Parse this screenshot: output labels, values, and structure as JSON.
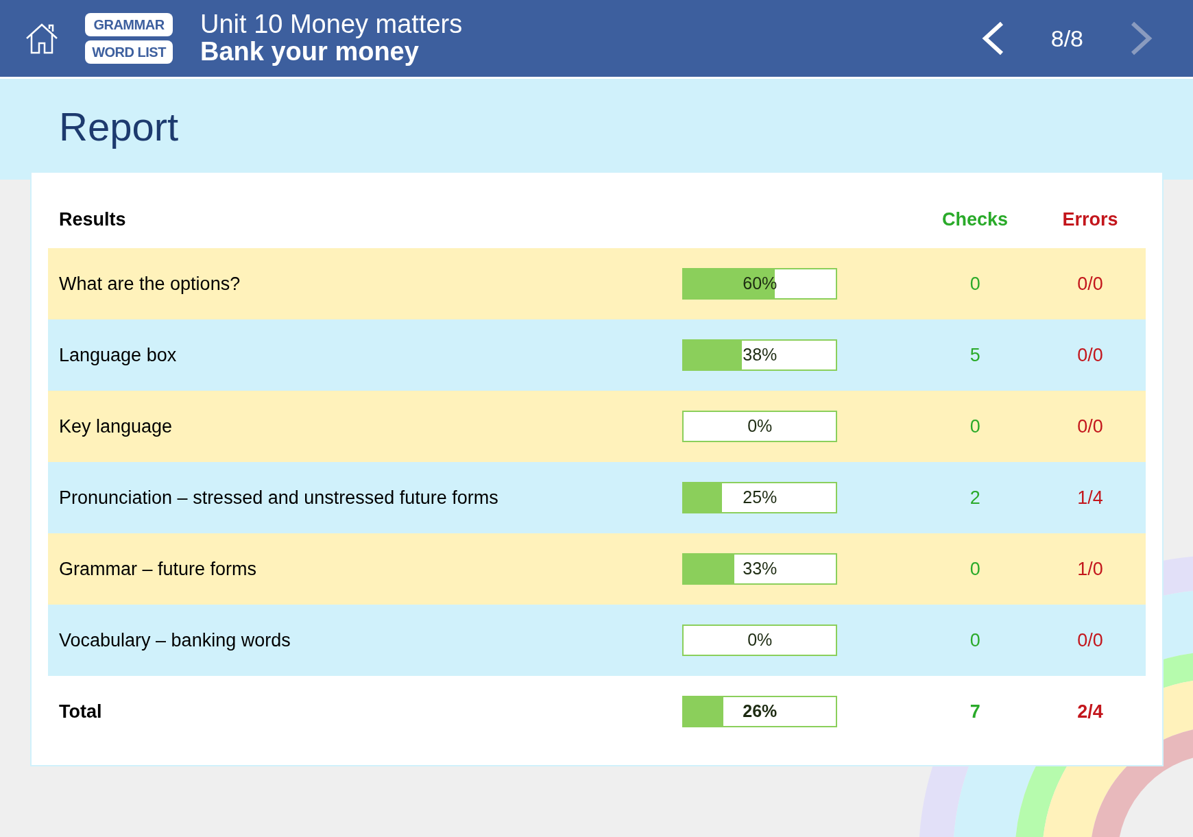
{
  "header": {
    "buttons": [
      {
        "label": "GRAMMAR"
      },
      {
        "label": "WORD LIST"
      }
    ],
    "unit_title": "Unit 10 Money matters",
    "lesson_title": "Bank your money",
    "prev": {
      "disabled": false
    },
    "page": "8/8",
    "next": {
      "disabled": true
    }
  },
  "title": "Report",
  "table": {
    "columns": [
      "Results",
      "Checks",
      "Errors"
    ],
    "rows": [
      {
        "name": "What are the options?",
        "level": 0.6,
        "percent": "60%",
        "checks": "0",
        "errors": "0/0"
      },
      {
        "name": "Language box",
        "level": 0.38,
        "percent": "38%",
        "checks": "5",
        "errors": "0/0"
      },
      {
        "name": "Key language",
        "level": 0,
        "percent": "0%",
        "checks": "0",
        "errors": "0/0"
      },
      {
        "name": "Pronunciation – stressed and unstressed future forms",
        "level": 0.25,
        "percent": "25%",
        "checks": "2",
        "errors": "1/4"
      },
      {
        "name": "Grammar – future forms",
        "level": 0.33,
        "percent": "33%",
        "checks": "0",
        "errors": "1/0"
      },
      {
        "name": "Vocabulary – banking words",
        "level": 0,
        "percent": "0%",
        "checks": "0",
        "errors": "0/0"
      }
    ],
    "total": {
      "name": "Total",
      "level": 0.26,
      "percent": "26%",
      "checks": "7",
      "errors": "2/4"
    }
  }
}
